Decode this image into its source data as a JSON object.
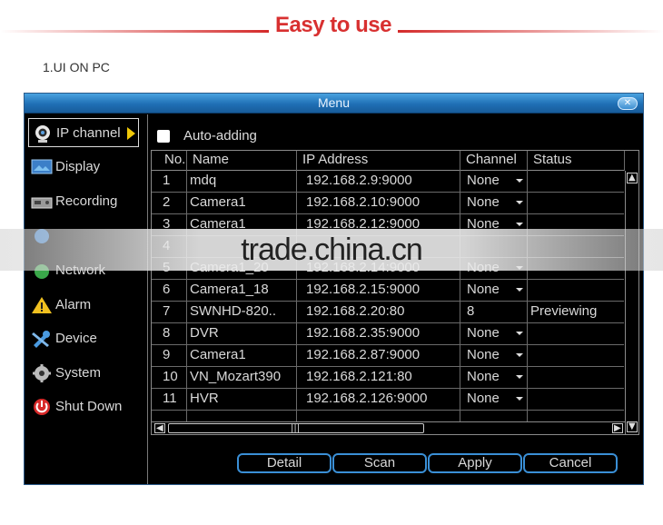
{
  "banner": {
    "title": "Easy to use",
    "subtitle": "1.UI ON PC"
  },
  "window": {
    "title": "Menu"
  },
  "sidebar": {
    "items": [
      {
        "label": "IP channel",
        "icon": "webcam-icon",
        "active": true
      },
      {
        "label": "Display",
        "icon": "monitor-icon"
      },
      {
        "label": "Recording",
        "icon": "recorder-icon"
      },
      {
        "label": "",
        "icon": "info-icon"
      },
      {
        "label": "Network",
        "icon": "network-icon"
      },
      {
        "label": "Alarm",
        "icon": "warning-icon"
      },
      {
        "label": "Device",
        "icon": "tools-icon"
      },
      {
        "label": "System",
        "icon": "gear-icon"
      },
      {
        "label": "Shut Down",
        "icon": "power-icon"
      }
    ]
  },
  "auto_adding": {
    "label": "Auto-adding",
    "checked": false
  },
  "table": {
    "headers": {
      "no": "No.",
      "name": "Name",
      "ip": "IP Address",
      "channel": "Channel",
      "status": "Status"
    },
    "rows": [
      {
        "no": "1",
        "name": "mdq",
        "ip": "192.168.2.9:9000",
        "channel": "None",
        "status": ""
      },
      {
        "no": "2",
        "name": "Camera1",
        "ip": "192.168.2.10:9000",
        "channel": "None",
        "status": ""
      },
      {
        "no": "3",
        "name": "Camera1",
        "ip": "192.168.2.12:9000",
        "channel": "None",
        "status": ""
      },
      {
        "no": "4",
        "name": "",
        "ip": "",
        "channel": "",
        "status": ""
      },
      {
        "no": "5",
        "name": "Camera1_20",
        "ip": "192.168.2.14:9000",
        "channel": "None",
        "status": ""
      },
      {
        "no": "6",
        "name": "Camera1_18",
        "ip": "192.168.2.15:9000",
        "channel": "None",
        "status": ""
      },
      {
        "no": "7",
        "name": "SWNHD-820..",
        "ip": "192.168.2.20:80",
        "channel": "8",
        "status": "Previewing"
      },
      {
        "no": "8",
        "name": "DVR",
        "ip": "192.168.2.35:9000",
        "channel": "None",
        "status": ""
      },
      {
        "no": "9",
        "name": "Camera1",
        "ip": "192.168.2.87:9000",
        "channel": "None",
        "status": ""
      },
      {
        "no": "10",
        "name": "VN_Mozart390",
        "ip": "192.168.2.121:80",
        "channel": "None",
        "status": ""
      },
      {
        "no": "11",
        "name": "HVR",
        "ip": "192.168.2.126:9000",
        "channel": "None",
        "status": ""
      }
    ]
  },
  "buttons": {
    "detail": "Detail",
    "scan": "Scan",
    "apply": "Apply",
    "cancel": "Cancel"
  },
  "watermark": "trade.china.cn",
  "colors": {
    "accent": "#d83030",
    "titlebar": "#1f6fb5",
    "button_border": "#3a8fd6",
    "active_arrow": "#f0c808"
  }
}
